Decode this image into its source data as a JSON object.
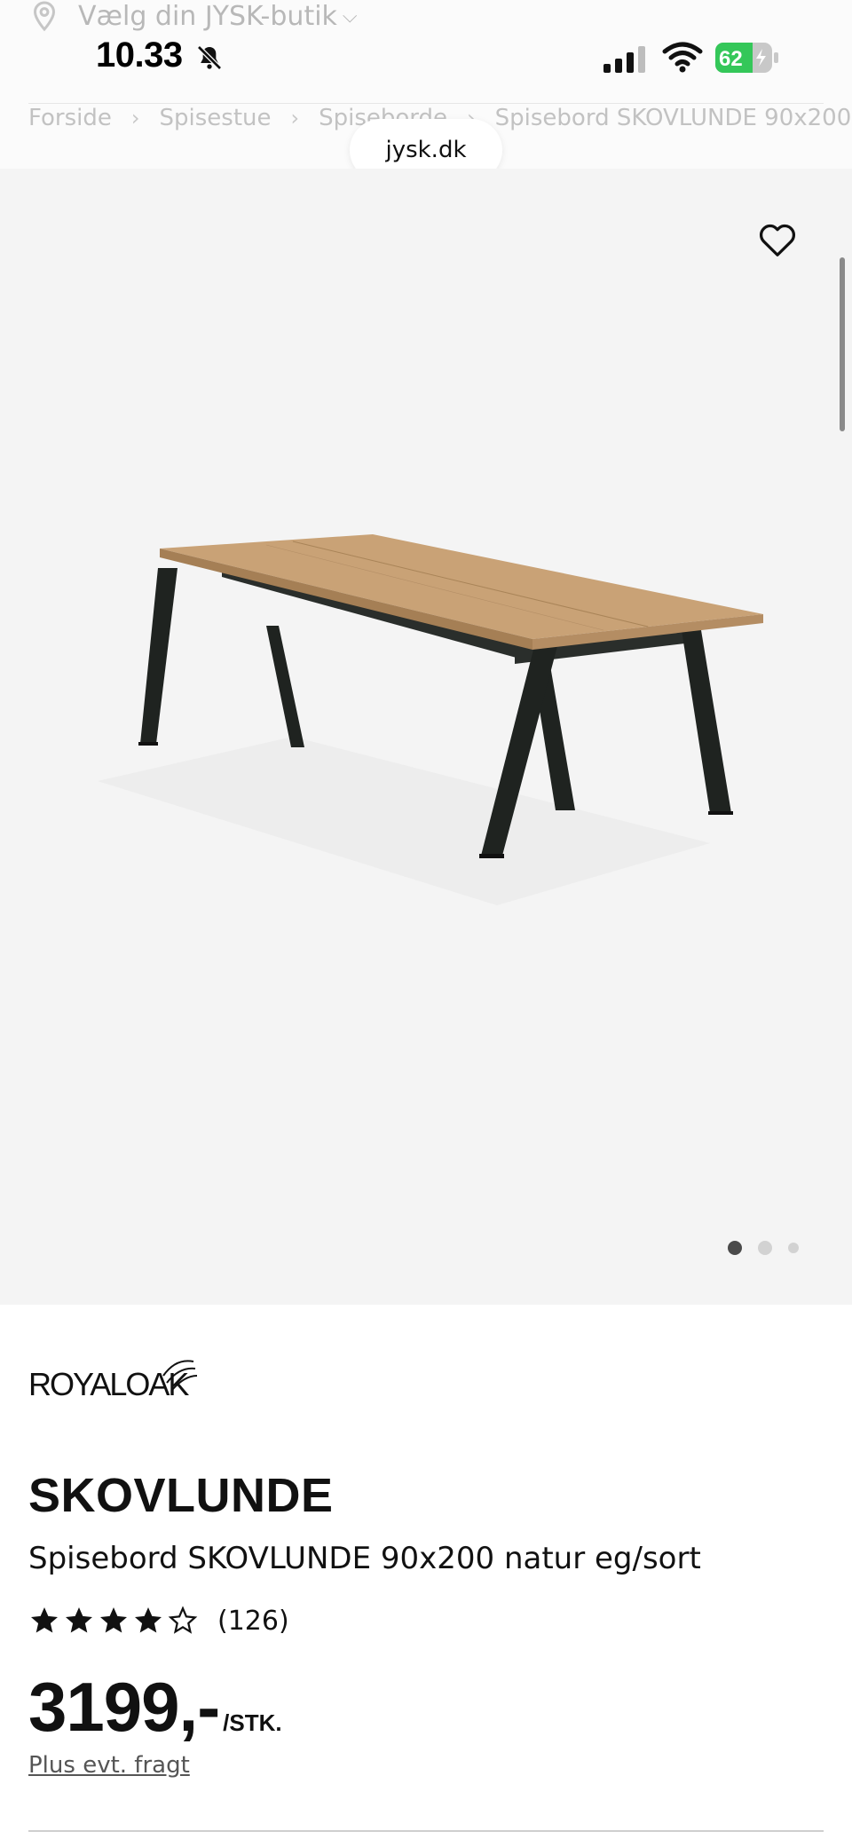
{
  "store_selector": {
    "label": "Vælg din JYSK-butik",
    "icon": "location-pin-icon"
  },
  "status_bar": {
    "time": "10.33",
    "battery": "62"
  },
  "breadcrumbs": [
    "Forside",
    "Spisestue",
    "Spiseborde",
    "Spisebord SKOVLUNDE 90x200"
  ],
  "url_pill": "jysk.dk",
  "gallery": {
    "image_count": 3,
    "active_index": 0
  },
  "product": {
    "brand": "ROYALOAK",
    "name": "SKOVLUNDE",
    "description": "Spisebord SKOVLUNDE 90x200 natur eg/sort",
    "rating": 4,
    "rating_max": 5,
    "review_count": "(126)",
    "price": "3199,-",
    "unit": "/STK.",
    "freight_link": "Plus evt. fragt"
  },
  "colors": {
    "battery_green": "#34c759",
    "table_leg": "#1f2320",
    "table_top": "#c9a276",
    "gallery_bg": "#f4f4f4"
  }
}
